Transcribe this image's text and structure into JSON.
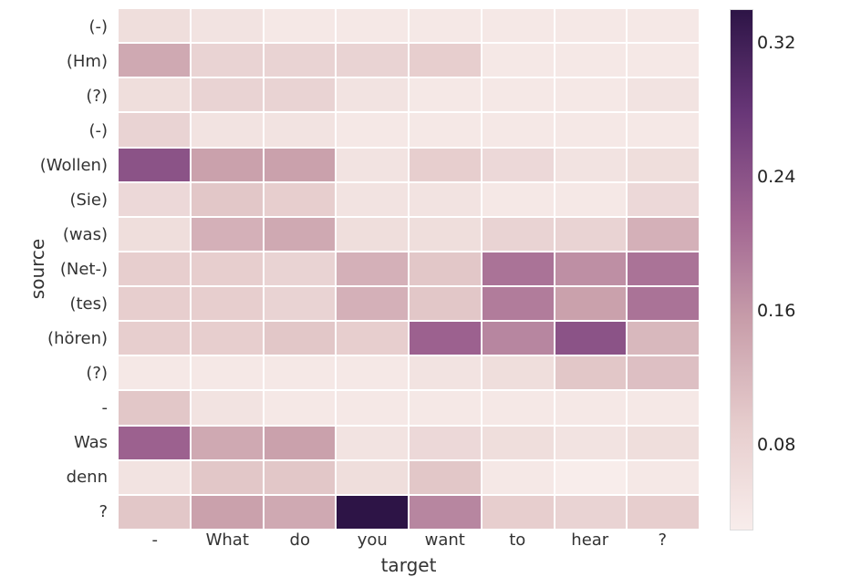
{
  "chart_data": {
    "type": "heatmap",
    "xlabel": "target",
    "ylabel": "source",
    "x_categories": [
      "-",
      "What",
      "do",
      "you",
      "want",
      "to",
      "hear",
      "?"
    ],
    "y_categories": [
      "(-)",
      "(Hm)",
      "(?)",
      "(-)",
      "(Wollen)",
      "(Sie)",
      "(was)",
      "(Net-)",
      "(tes)",
      "(hören)",
      "(?)",
      "-",
      "Was",
      "denn",
      "?"
    ],
    "matrix": [
      [
        0.06,
        0.05,
        0.04,
        0.04,
        0.04,
        0.04,
        0.04,
        0.04
      ],
      [
        0.14,
        0.08,
        0.08,
        0.08,
        0.09,
        0.04,
        0.04,
        0.04
      ],
      [
        0.06,
        0.08,
        0.08,
        0.05,
        0.04,
        0.04,
        0.04,
        0.05
      ],
      [
        0.08,
        0.05,
        0.05,
        0.04,
        0.04,
        0.04,
        0.04,
        0.04
      ],
      [
        0.24,
        0.15,
        0.15,
        0.05,
        0.09,
        0.07,
        0.05,
        0.06
      ],
      [
        0.07,
        0.1,
        0.09,
        0.05,
        0.05,
        0.04,
        0.04,
        0.07
      ],
      [
        0.06,
        0.13,
        0.14,
        0.06,
        0.06,
        0.08,
        0.08,
        0.13
      ],
      [
        0.09,
        0.09,
        0.08,
        0.13,
        0.1,
        0.2,
        0.17,
        0.2
      ],
      [
        0.09,
        0.09,
        0.08,
        0.13,
        0.1,
        0.19,
        0.15,
        0.2
      ],
      [
        0.09,
        0.09,
        0.1,
        0.09,
        0.22,
        0.18,
        0.24,
        0.12
      ],
      [
        0.04,
        0.04,
        0.04,
        0.04,
        0.05,
        0.06,
        0.1,
        0.11
      ],
      [
        0.1,
        0.05,
        0.04,
        0.04,
        0.04,
        0.04,
        0.04,
        0.04
      ],
      [
        0.22,
        0.14,
        0.15,
        0.05,
        0.07,
        0.06,
        0.05,
        0.06
      ],
      [
        0.05,
        0.1,
        0.1,
        0.06,
        0.1,
        0.04,
        0.03,
        0.04
      ],
      [
        0.1,
        0.15,
        0.14,
        0.34,
        0.18,
        0.09,
        0.08,
        0.09
      ]
    ],
    "colorbar": {
      "min": 0.03,
      "max": 0.34,
      "ticks": [
        0.08,
        0.16,
        0.24,
        0.32
      ],
      "tick_labels": [
        "0.08",
        "0.16",
        "0.24",
        "0.32"
      ],
      "cmap_low_rgb": [
        248,
        237,
        235
      ],
      "cmap_high_rgb": [
        45,
        20,
        70
      ]
    }
  }
}
